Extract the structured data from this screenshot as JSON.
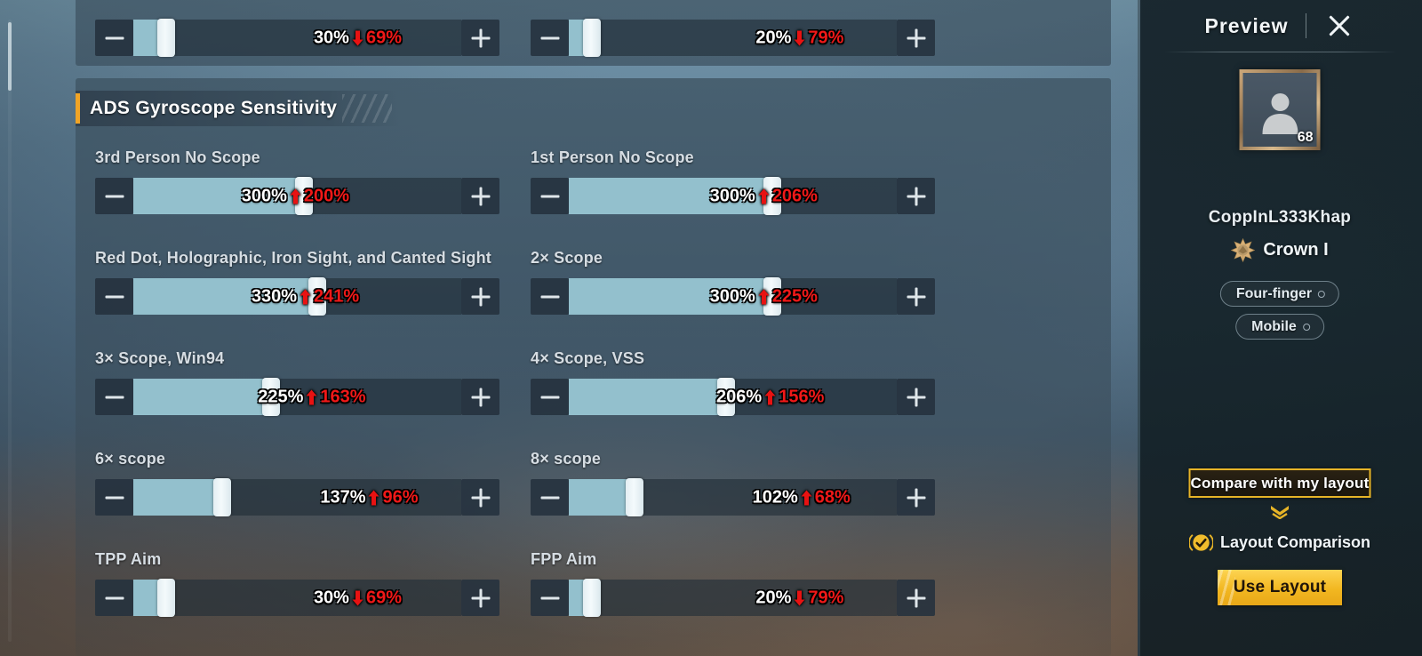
{
  "section": {
    "title": "ADS Gyroscope Sensitivity"
  },
  "top_partial_rows": [
    {
      "current": "30%",
      "delta": "69%",
      "direction": "down",
      "fill_pct": 10,
      "readout_left_pct": 55
    },
    {
      "current": "20%",
      "delta": "79%",
      "direction": "down",
      "fill_pct": 7,
      "readout_left_pct": 57
    }
  ],
  "settings": [
    {
      "label": "3rd Person No Scope",
      "current": "300%",
      "delta": "200%",
      "direction": "up",
      "fill_pct": 52,
      "readout_left_pct": 33
    },
    {
      "label": "1st Person No Scope",
      "current": "300%",
      "delta": "206%",
      "direction": "up",
      "fill_pct": 62,
      "readout_left_pct": 43
    },
    {
      "label": "Red Dot, Holographic, Iron Sight, and Canted Sight",
      "current": "330%",
      "delta": "241%",
      "direction": "up",
      "fill_pct": 56,
      "readout_left_pct": 36
    },
    {
      "label": "2× Scope",
      "current": "300%",
      "delta": "225%",
      "direction": "up",
      "fill_pct": 62,
      "readout_left_pct": 43
    },
    {
      "label": "3× Scope, Win94",
      "current": "225%",
      "delta": "163%",
      "direction": "up",
      "fill_pct": 42,
      "readout_left_pct": 38
    },
    {
      "label": "4× Scope, VSS",
      "current": "206%",
      "delta": "156%",
      "direction": "up",
      "fill_pct": 48,
      "readout_left_pct": 45
    },
    {
      "label": "6× scope",
      "current": "137%",
      "delta": "96%",
      "direction": "up",
      "fill_pct": 27,
      "readout_left_pct": 57
    },
    {
      "label": "8× scope",
      "current": "102%",
      "delta": "68%",
      "direction": "up",
      "fill_pct": 20,
      "readout_left_pct": 56
    },
    {
      "label": "TPP Aim",
      "current": "30%",
      "delta": "69%",
      "direction": "down",
      "fill_pct": 10,
      "readout_left_pct": 55
    },
    {
      "label": "FPP Aim",
      "current": "20%",
      "delta": "79%",
      "direction": "down",
      "fill_pct": 7,
      "readout_left_pct": 57
    }
  ],
  "sidebar": {
    "title": "Preview",
    "close_icon": "close-icon",
    "avatar": {
      "icon": "person-avatar-icon",
      "level": "68"
    },
    "username": "CoppInL333Khap",
    "rank": {
      "icon": "crown-rank-icon",
      "label": "Crown I"
    },
    "tags": [
      {
        "label": "Four-finger"
      },
      {
        "label": "Mobile"
      }
    ],
    "compare_button": "Compare with my layout",
    "chevron_icon": "chevron-down-icon",
    "layout_comparison": {
      "check_icon": "check-circle-icon",
      "label": "Layout Comparison"
    },
    "use_layout_button": "Use Layout"
  },
  "colors": {
    "accent_orange": "#f0a426",
    "slider_fill": "#93c0cd",
    "delta_red": "#f01818",
    "gold": "#e7b427",
    "use_layout_yellow": "#f2b721"
  }
}
